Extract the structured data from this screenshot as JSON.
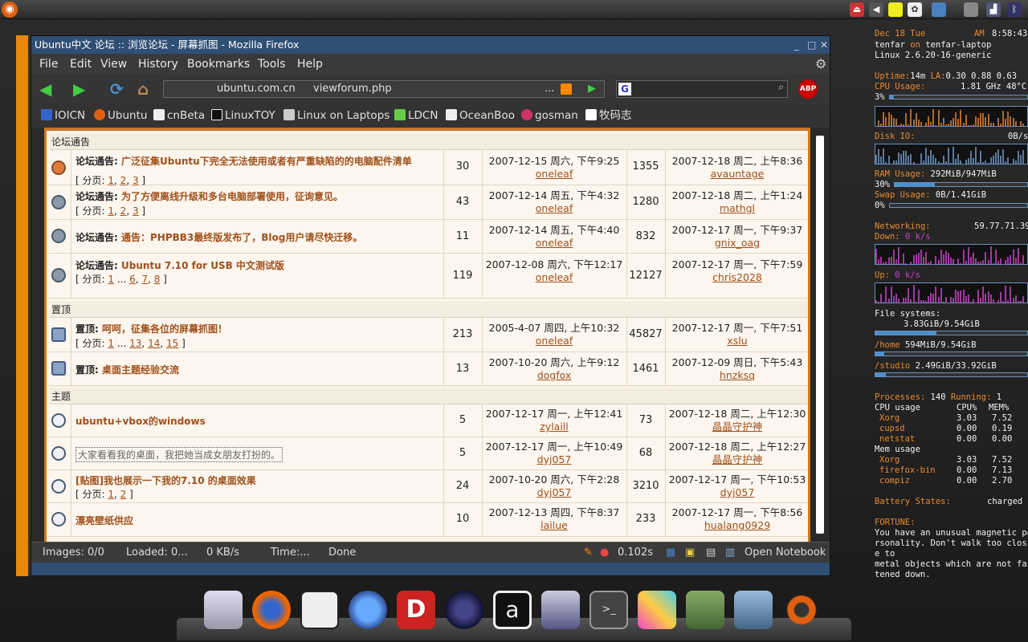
{
  "topbar": {
    "ubuntu_glyph": "◉",
    "tray": [
      "logout-icon",
      "volume-icon",
      "notes-icon",
      "gnome-foot-icon",
      "monitor-icon",
      "drive-icon",
      "network-signal-icon",
      "bluetooth-icon"
    ]
  },
  "window": {
    "title": "Ubuntu中文 论坛 :: 浏览论坛 - 屏幕抓图 - Mozilla Firefox",
    "controls": [
      "_",
      "□",
      "✕"
    ]
  },
  "menu": [
    "File",
    "Edit",
    "View",
    "History",
    "Bookmarks",
    "Tools",
    "Help"
  ],
  "nav": {
    "url_host": "ubuntu.com.cn",
    "url_path": "viewforum.php",
    "url_ellipsis": "...",
    "abp": "ABP"
  },
  "bookmarks": [
    "IOICN",
    "Ubuntu",
    "cnBeta",
    "LinuxTOY",
    "Linux on Laptops",
    "LDCN",
    "OceanBoo",
    "gosman",
    "牧码志"
  ],
  "sections": {
    "announce": "论坛通告",
    "sticky": "置顶",
    "topics": "主题"
  },
  "rows": [
    {
      "prefix": "论坛通告:",
      "title": "广泛征集Ubuntu下完全无法使用或者有严重缺陷的的电脑配件清单",
      "pages_lbl": "[",
      "pages_word": "分页:",
      "p": [
        "1",
        "2",
        "3"
      ],
      "pages_end": "]",
      "replies": "30",
      "first_date": "2007-12-15 周六, 下午9:25",
      "first_user": "oneleaf",
      "views": "1355",
      "last_date": "2007-12-18 周二, 上午8:36",
      "last_user": "avauntage"
    },
    {
      "prefix": "论坛通告:",
      "title": "为了方便离线升级和多台电脑部署使用，征询意见。",
      "pages_lbl": "[",
      "pages_word": "分页:",
      "p": [
        "1",
        "2",
        "3"
      ],
      "pages_end": "]",
      "replies": "43",
      "first_date": "2007-12-14 周五, 下午4:32",
      "first_user": "oneleaf",
      "views": "1280",
      "last_date": "2007-12-18 周二, 上午1:24",
      "last_user": "mathgl"
    },
    {
      "prefix": "论坛通告:",
      "title": "通告：PHPBB3最终版发布了，Blog用户请尽快迁移。",
      "replies": "11",
      "first_date": "2007-12-14 周五, 下午4:40",
      "first_user": "oneleaf",
      "views": "832",
      "last_date": "2007-12-17 周一, 下午9:37",
      "last_user": "gnix_oag"
    },
    {
      "prefix": "论坛通告:",
      "title": "Ubuntu 7.10 for USB 中文测试版",
      "pages_lbl": "[",
      "pages_word": "分页:",
      "p": [
        "1",
        "...",
        "6",
        "7",
        "8"
      ],
      "pages_end": "]",
      "replies": "119",
      "first_date": "2007-12-08 周六, 下午12:17",
      "first_user": "oneleaf",
      "views": "12127",
      "last_date": "2007-12-17 周一, 下午7:59",
      "last_user": "chris2028"
    },
    {
      "prefix": "置顶:",
      "title": "呵呵，征集各位的屏幕抓图！",
      "pages_lbl": "[",
      "pages_word": "分页:",
      "p": [
        "1",
        "...",
        "13",
        "14",
        "15"
      ],
      "pages_end": "]",
      "replies": "213",
      "first_date": "2005-4-07 周四, 上午10:32",
      "first_user": "oneleaf",
      "views": "45827",
      "last_date": "2007-12-17 周一, 下午7:51",
      "last_user": "xslu"
    },
    {
      "prefix": "置顶:",
      "title": "桌面主题经验交流",
      "replies": "13",
      "first_date": "2007-10-20 周六, 上午9:12",
      "first_user": "dogfox",
      "views": "1461",
      "last_date": "2007-12-09 周日, 下午5:43",
      "last_user": "hnzksq"
    },
    {
      "prefix": "",
      "title": "ubuntu+vbox的windows",
      "replies": "5",
      "first_date": "2007-12-17 周一, 上午12:41",
      "first_user": "zylaill",
      "views": "73",
      "last_date": "2007-12-18 周二, 上午12:30",
      "last_user": "晶晶守护神"
    },
    {
      "prefix": "",
      "title": "大家看看我的桌面，我把她当成女朋友打扮的。",
      "replies": "5",
      "first_date": "2007-12-17 周一, 上午10:49",
      "first_user": "dyj057",
      "views": "68",
      "last_date": "2007-12-18 周二, 上午12:27",
      "last_user": "晶晶守护神"
    },
    {
      "prefix": "",
      "title": "[贴图]我也展示一下我的7.10 的桌面效果",
      "pages_lbl": "[",
      "pages_word": "分页:",
      "p": [
        "1",
        "2"
      ],
      "pages_end": "]",
      "replies": "24",
      "first_date": "2007-10-20 周六, 下午2:28",
      "first_user": "dyj057",
      "views": "3210",
      "last_date": "2007-12-17 周一, 下午10:53",
      "last_user": "dyj057"
    },
    {
      "prefix": "",
      "title": "漂亮壁纸供应",
      "replies": "10",
      "first_date": "2007-12-13 周四, 下午8:37",
      "first_user": "lailue",
      "views": "233",
      "last_date": "2007-12-17 周一, 下午8:56",
      "last_user": "hualang0929"
    }
  ],
  "status": {
    "images": "Images: 0/0",
    "loaded": "Loaded: 0...",
    "speed": "0 KB/s",
    "time": "Time:...",
    "done": "Done",
    "delay": "0.102s",
    "notebook": "Open Notebook"
  },
  "conky": {
    "date": "Dec  18  Tue",
    "ampm": "AM",
    "time": "8:58:43",
    "user": "tenfar",
    "on": "on",
    "host": "tenfar-laptop",
    "kernel": "Linux 2.6.20-16-generic",
    "uptime_lbl": "Uptime:",
    "uptime": "14m",
    "la_lbl": "LA:",
    "la": "0.30 0.88 0.63",
    "cpu_lbl": "CPU Usage:",
    "cpu": "1.81 GHz 48°C",
    "cpu_pct": "3%",
    "cpu_frac": 0.03,
    "disk_lbl": "Disk IO:",
    "disk": "0B/s",
    "ram_lbl": "RAM Usage:",
    "ram": "292MiB/947MiB",
    "ram_pct": "30%",
    "ram_frac": 0.3,
    "swap_lbl": "Swap Usage:",
    "swap": "0B/1.41GiB",
    "swap_pct": "0%",
    "swap_frac": 0.0,
    "net_lbl": "Networking:",
    "ip": "59.77.71.39",
    "down_lbl": "Down:",
    "down": "0 k/s",
    "up_lbl": "Up:",
    "up": "0 k/s",
    "fs_lbl": "File systems:",
    "fs_root": "3.83GiB/9.54GiB",
    "fs_root_frac": 0.4,
    "home_lbl": "/home",
    "fs_home": "594MiB/9.54GiB",
    "fs_home_frac": 0.06,
    "studio_lbl": "/studio",
    "fs_studio": "2.49GiB/33.92GiB",
    "fs_studio_frac": 0.07,
    "proc_lbl": "Processes:",
    "proc": "140",
    "run_lbl": "Running:",
    "run": "1",
    "cpu_usage_lbl": "CPU usage",
    "cpu_col": "CPU%",
    "mem_col": "MEM%",
    "cpu_procs": [
      [
        "Xorg",
        "3.03",
        "7.52"
      ],
      [
        "cupsd",
        "0.00",
        "0.19"
      ],
      [
        "netstat",
        "0.00",
        "0.00"
      ]
    ],
    "mem_usage_lbl": "Mem usage",
    "mem_procs": [
      [
        "Xorg",
        "3.03",
        "7.52"
      ],
      [
        "firefox-bin",
        "0.00",
        "7.13"
      ],
      [
        "compiz",
        "0.00",
        "2.70"
      ]
    ],
    "batt_lbl": "Battery States:",
    "batt": "charged",
    "fortune_lbl": "FORTUNE:",
    "fortune": [
      "You have an unusual magnetic pe",
      "rsonality.  Don't walk too clos",
      "e to",
      "metal objects which are not fas",
      "tened down."
    ]
  },
  "dock": [
    "computer-icon",
    "firefox-icon",
    "gimp-horse-icon",
    "pidgin-icon",
    "dictionary-icon",
    "eclipse-icon",
    "amarok-icon",
    "mplayer-icon",
    "terminal-icon",
    "art-icon",
    "books-icon",
    "folder-icon",
    "ubuntu-icon"
  ]
}
